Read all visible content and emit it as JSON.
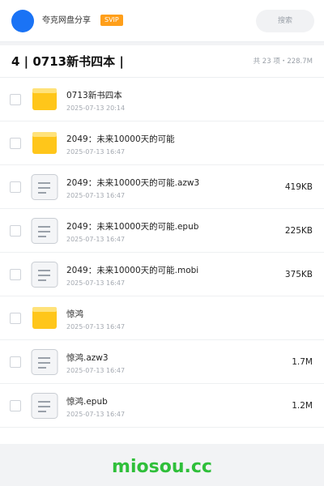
{
  "header": {
    "user_name": "夸克网盘分享",
    "vip_label": "SVIP",
    "search_placeholder": "搜索"
  },
  "title": {
    "text": "4 | 0713新书四本 |",
    "summary": "共 23 项・228.7M"
  },
  "files": [
    {
      "name": "0713新书四本",
      "date": "2025-07-13 20:14",
      "size": "",
      "icon": "folder-icon"
    },
    {
      "name": "2049：未来10000天的可能",
      "date": "2025-07-13 16:47",
      "size": "",
      "icon": "folder-icon"
    },
    {
      "name": "2049：未来10000天的可能.azw3",
      "date": "2025-07-13 16:47",
      "size": "419KB",
      "icon": "document-icon"
    },
    {
      "name": "2049：未来10000天的可能.epub",
      "date": "2025-07-13 16:47",
      "size": "225KB",
      "icon": "document-icon"
    },
    {
      "name": "2049：未来10000天的可能.mobi",
      "date": "2025-07-13 16:47",
      "size": "375KB",
      "icon": "document-icon"
    },
    {
      "name": "惊鸿",
      "date": "2025-07-13 16:47",
      "size": "",
      "icon": "folder-icon"
    },
    {
      "name": "惊鸿.azw3",
      "date": "2025-07-13 16:47",
      "size": "1.7M",
      "icon": "document-icon"
    },
    {
      "name": "惊鸿.epub",
      "date": "2025-07-13 16:47",
      "size": "1.2M",
      "icon": "document-icon"
    }
  ],
  "footer": {
    "logo_text": "miosou.cc"
  },
  "colors": {
    "accent_blue": "#1a73f5",
    "vip_orange": "#ff9f1a",
    "folder_yellow": "#ffc61a",
    "logo_green": "#2fbf3a"
  }
}
